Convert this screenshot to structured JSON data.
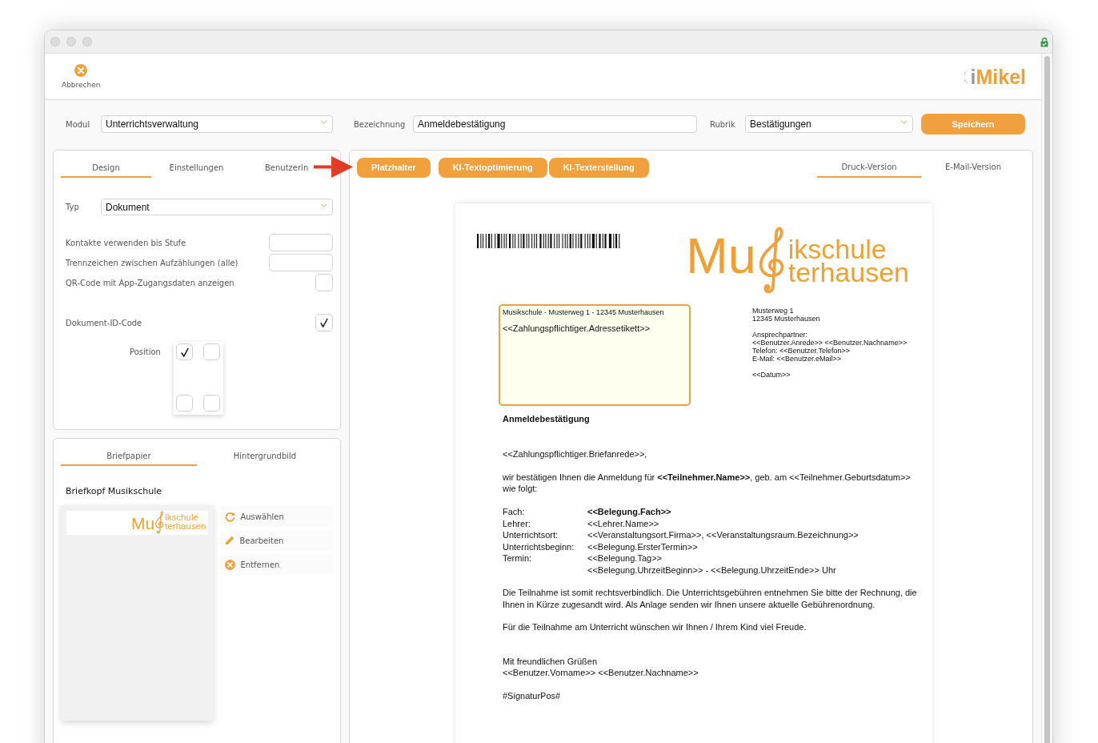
{
  "toolbar": {
    "cancel_button": "Abbrechen",
    "logo": {
      "prefix": "i",
      "name": "Mikel"
    }
  },
  "form": {
    "fields": [
      {
        "label": "Modul",
        "value": "Unterrichtsverwaltung",
        "kind": "select"
      },
      {
        "label": "Bezeichnung",
        "value": "Anmeldebestätigung",
        "kind": "text"
      },
      {
        "label": "Rubrik",
        "value": "Bestätigungen",
        "kind": "select"
      }
    ],
    "save_button": "Speichern"
  },
  "settings_panel": {
    "tabs": [
      {
        "label": "Design",
        "selected": true
      },
      {
        "label": "Einstellungen",
        "selected": false
      },
      {
        "label": "Benutzerin",
        "selected": false
      }
    ],
    "type_field": {
      "label": "Typ",
      "value": "Dokument"
    },
    "options": [
      {
        "label": "Kontakte verwenden bis Stufe",
        "kind": "input"
      },
      {
        "label": "Trennzeichen zwischen Aufzählungen (alle)",
        "kind": "input"
      },
      {
        "label": "QR-Code mit App-Zugangsdaten anzeigen",
        "kind": "checkbox",
        "checked": false
      }
    ],
    "id_code": {
      "label": "Dokument-ID-Code",
      "checked": true
    },
    "position": {
      "label": "Position",
      "corners": [
        {
          "checked": true
        },
        {
          "checked": false
        },
        {
          "checked": false
        },
        {
          "checked": false
        }
      ]
    }
  },
  "stationery_panel": {
    "tabs": [
      {
        "label": "Briefpapier",
        "selected": true
      },
      {
        "label": "Hintergrundbild",
        "selected": false
      }
    ],
    "title": "Briefkopf Musikschule",
    "preview_logo": {
      "part_1": "Mu",
      "part_2": "ikschule",
      "part_3": "terhausen"
    },
    "actions": [
      {
        "label": "Auswählen",
        "kind": "select"
      },
      {
        "label": "Bearbeiten",
        "kind": "edit"
      },
      {
        "label": "Entfernen",
        "kind": "remove"
      }
    ]
  },
  "editor": {
    "buttons": [
      "Platzhalter",
      "KI-Textoptimierung",
      "KI-Texterstellung"
    ],
    "tabs": [
      {
        "label": "Druck-Version",
        "selected": true
      },
      {
        "label": "E-Mail-Version",
        "selected": false
      }
    ],
    "document": {
      "logo": {
        "part_1": "Mu",
        "part_2": "ikschule",
        "part_3": "terhausen"
      },
      "address_box": {
        "sender": "Musikschule - Musterweg 1 - 12345 Musterhausen",
        "label": "<<Zahlungspflichtiger.Adressetikett>>"
      },
      "info": [
        [
          "Musterweg 1",
          "12345 Musterhausen"
        ],
        [
          "Ansprechpartner:",
          "<<Benutzer.Anrede>> <<Benutzer.Nachname>>",
          "Telefon: <<Benutzer.Telefon>>",
          "E-Mail: <<Benutzer.eMail>>"
        ],
        [
          "<<Datum>>"
        ]
      ],
      "title": "Anmeldebestätigung",
      "salutation": "<<Zahlungspflichtiger.Briefanrede>>,",
      "intro": "wir bestätigen Ihnen die Anmeldung für **<<Teilnehmer.Name>>**, geb. am <<Teilnehmer.Geburtsdatum>> wie folgt:",
      "details": [
        {
          "label": "Fach:",
          "value": "<<Belegung.Fach>>",
          "emphasis": true
        },
        {
          "label": "Lehrer:",
          "value": "<<Lehrer.Name>>",
          "emphasis": false
        },
        {
          "label": "Unterrichtsort:",
          "value": "<<Veranstaltungsort.Firma>>, <<Veranstaltungsraum.Bezeichnung>>",
          "emphasis": false
        },
        {
          "label": "Unterrichtsbeginn:",
          "value": "<<Belegung.ErsterTermin>>",
          "emphasis": false
        },
        {
          "label": "Termin:",
          "value": "<<Belegung.Tag>>",
          "emphasis": false
        },
        {
          "value": "<<Belegung.UhrzeitBeginn>> - <<Belegung.UhrzeitEnde>> Uhr",
          "emphasis": false
        }
      ],
      "paragraphs": [
        "Die Teilnahme ist somit rechtsverbindlich. Die Unterrichtsgebühren entnehmen Sie bitte der Rechnung, die Ihnen in Kürze zugesandt wird. Als Anlage senden wir Ihnen unsere aktuelle Gebührenordnung.",
        "Für die Teilnahme am Unterricht wünschen wir Ihnen / Ihrem Kind viel Freude."
      ],
      "closing": [
        "Mit freundlichen Grüßen",
        "<<Benutzer.Vorname>> <<Benutzer.Nachname>>"
      ],
      "signature": "#SignaturPos#"
    }
  }
}
